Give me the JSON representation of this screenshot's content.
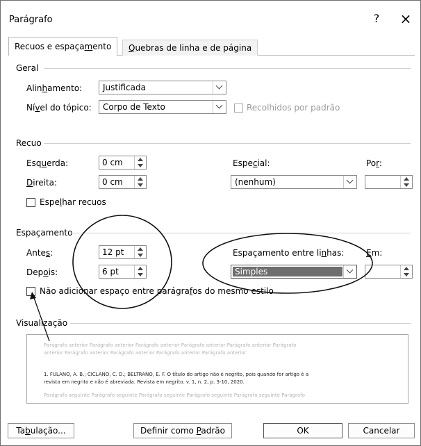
{
  "dialog": {
    "title": "Parágrafo",
    "help_label": "?",
    "close_label": "×"
  },
  "tabs": [
    {
      "pre": "Recuos e espaça",
      "key": "m",
      "post": "ento"
    },
    {
      "pre": "",
      "key": "Q",
      "post": "uebras de linha e de página"
    }
  ],
  "geral": {
    "section_label": "Geral",
    "alinhamento": {
      "pre": "Alin",
      "key": "h",
      "post": "amento:",
      "value": "Justificada"
    },
    "nivel": {
      "pre": "Ní",
      "key": "v",
      "post": "el do tópico:",
      "value": "Corpo de Texto"
    },
    "recolhidos_label": "Recolhidos por padrão"
  },
  "recuo": {
    "section_label": "Recuo",
    "esquerda": {
      "pre": "Esq",
      "key": "u",
      "post": "erda:",
      "value": "0 cm"
    },
    "direita": {
      "pre": "",
      "key": "D",
      "post": "ireita:",
      "value": "0 cm"
    },
    "especial": {
      "pre": "Espe",
      "key": "c",
      "post": "ial:",
      "value": "(nenhum)"
    },
    "por": {
      "pre": "Po",
      "key": "r",
      "post": ":",
      "value": ""
    },
    "espelhar": {
      "pre": "Espe",
      "key": "l",
      "post": "har recuos"
    }
  },
  "espacamento": {
    "section_label": "Espaçamento",
    "antes": {
      "pre": "Ante",
      "key": "s",
      "post": ":",
      "value": "12 pt"
    },
    "depois": {
      "pre": "Dep",
      "key": "o",
      "post": "is:",
      "value": "6 pt"
    },
    "entre_linhas": {
      "pre": "Espaçamento entre li",
      "key": "n",
      "post": "has:",
      "value": "Simples"
    },
    "em": {
      "pre": "",
      "key": "E",
      "post": "m:",
      "value": ""
    },
    "nao_adicionar": {
      "pre": "Não adicionar espaço entre parágra",
      "key": "f",
      "post": "os do mesmo estilo"
    }
  },
  "visualizacao": {
    "section_label": "Visualização",
    "preview_before_1": "Parágrafo anterior Parágrafo anterior Parágrafo anterior Parágrafo anterior Parágrafo anterior Parágrafo",
    "preview_before_2": "anterior Parágrafo anterior Parágrafo anterior Parágrafo anterior Parágrafo anterior",
    "preview_text_1": "1. FULANO, A. B.; CICLANO, C. D.; BELTRANO, E. F. O título do artigo não é negrito, pois quando for artigo é a",
    "preview_text_2": "revista em negrito e não é abreviada. Revista em negrito. v. 1, n. 2, p. 3-10, 2020.",
    "preview_after_1": "Parágrafo seguinte Parágrafo seguinte Parágrafo seguinte Parágrafo seguinte Parágrafo seguinte Parágrafo"
  },
  "buttons": {
    "tabulacao": {
      "pre": "Ta",
      "key": "b",
      "post": "ulação..."
    },
    "definir": {
      "pre": "Definir como ",
      "key": "P",
      "post": "adrão"
    },
    "ok": "OK",
    "cancelar": "Cancelar"
  }
}
